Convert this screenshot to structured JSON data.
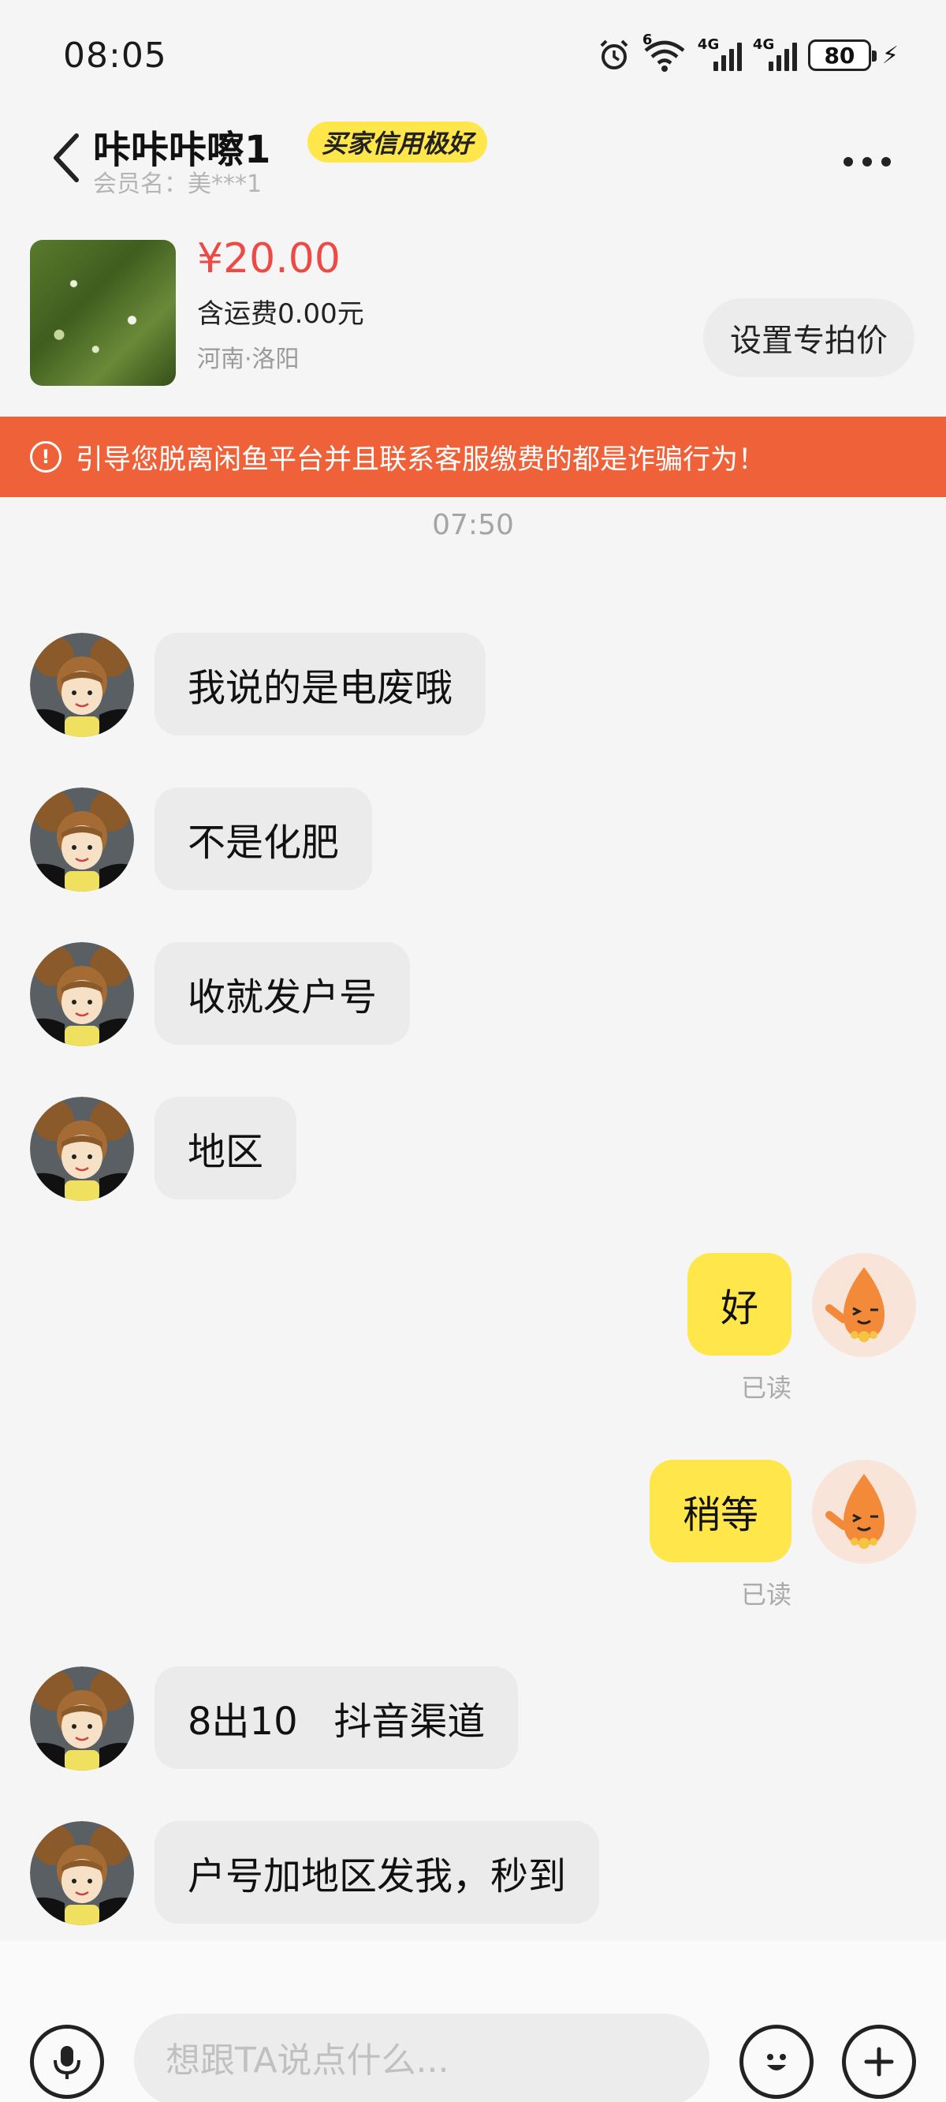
{
  "status_bar": {
    "time": "08:05",
    "wifi_badge": "6",
    "network_1": "4G",
    "network_2": "4G",
    "battery": "80"
  },
  "header": {
    "nickname": "咔咔咔嚓1",
    "credit_badge": "买家信用极好",
    "member_name": "会员名：美***1"
  },
  "product": {
    "price": "¥20.00",
    "shipping": "含运费0.00元",
    "location": "河南·洛阳",
    "set_price_button": "设置专拍价"
  },
  "warning": {
    "text": "引导您脱离闲鱼平台并且联系客服缴费的都是诈骗行为！"
  },
  "chat": {
    "timestamp": "07:50",
    "messages": [
      {
        "from": "other",
        "text": "我说的是电废哦"
      },
      {
        "from": "other",
        "text": "不是化肥"
      },
      {
        "from": "other",
        "text": "收就发户号"
      },
      {
        "from": "other",
        "text": "地区"
      },
      {
        "from": "me",
        "text": "好",
        "status": "已读"
      },
      {
        "from": "me",
        "text": "稍等",
        "status": "已读"
      },
      {
        "from": "other",
        "text": "8出10   抖音渠道"
      },
      {
        "from": "other",
        "text": "户号加地区发我，秒到"
      }
    ]
  },
  "input_bar": {
    "placeholder": "想跟TA说点什么..."
  },
  "icons": {
    "back": "back-arrow-icon",
    "more": "more-dots-icon",
    "mic": "microphone-icon",
    "emoji": "emoji-icon",
    "plus": "plus-icon",
    "warning": "warning-circle-icon"
  }
}
